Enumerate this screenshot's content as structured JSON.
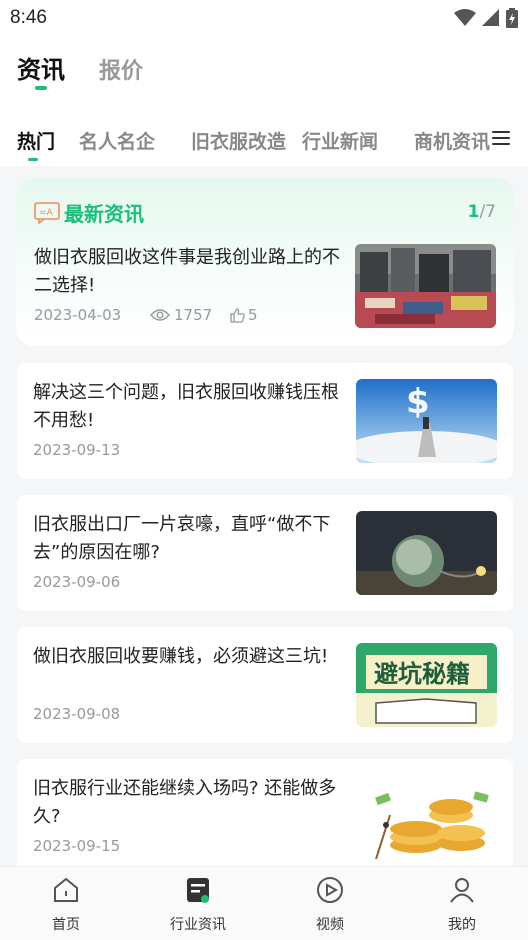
{
  "status_bar": {
    "time": "8:46"
  },
  "header": {
    "tabs": [
      {
        "label": "资讯",
        "active": true
      },
      {
        "label": "报价",
        "active": false
      }
    ]
  },
  "categories": {
    "items": [
      "热门",
      "名人名企",
      "旧衣服改造",
      "行业新闻",
      "商机资讯"
    ],
    "active_index": 0,
    "menu_icon": "menu-icon"
  },
  "featured": {
    "section_title": "最新资讯",
    "page_current": "1",
    "page_total": "/7",
    "title": "做旧衣服回收这件事是我创业路上的不二选择!",
    "date": "2023-04-03",
    "views": "1757",
    "likes": "5"
  },
  "articles": [
    {
      "title": "解决这三个问题，旧衣服回收赚钱压根不用愁!",
      "date": "2023-09-13"
    },
    {
      "title": "旧衣服出口厂一片哀嚎，直呼“做不下去”的原因在哪?",
      "date": "2023-09-06"
    },
    {
      "title": "做旧衣服回收要赚钱，必须避这三坑!",
      "date": "2023-09-08",
      "image_text": "避坑秘籍"
    },
    {
      "title": "旧衣服行业还能继续入场吗? 还能做多久?",
      "date": "2023-09-15"
    }
  ],
  "bottom_nav": [
    {
      "label": "首页",
      "icon": "home-icon"
    },
    {
      "label": "行业资讯",
      "icon": "news-icon",
      "active": true
    },
    {
      "label": "视频",
      "icon": "video-icon"
    },
    {
      "label": "我的",
      "icon": "profile-icon"
    }
  ],
  "colors": {
    "accent": "#18c07a",
    "muted": "#999999",
    "text": "#222222"
  }
}
